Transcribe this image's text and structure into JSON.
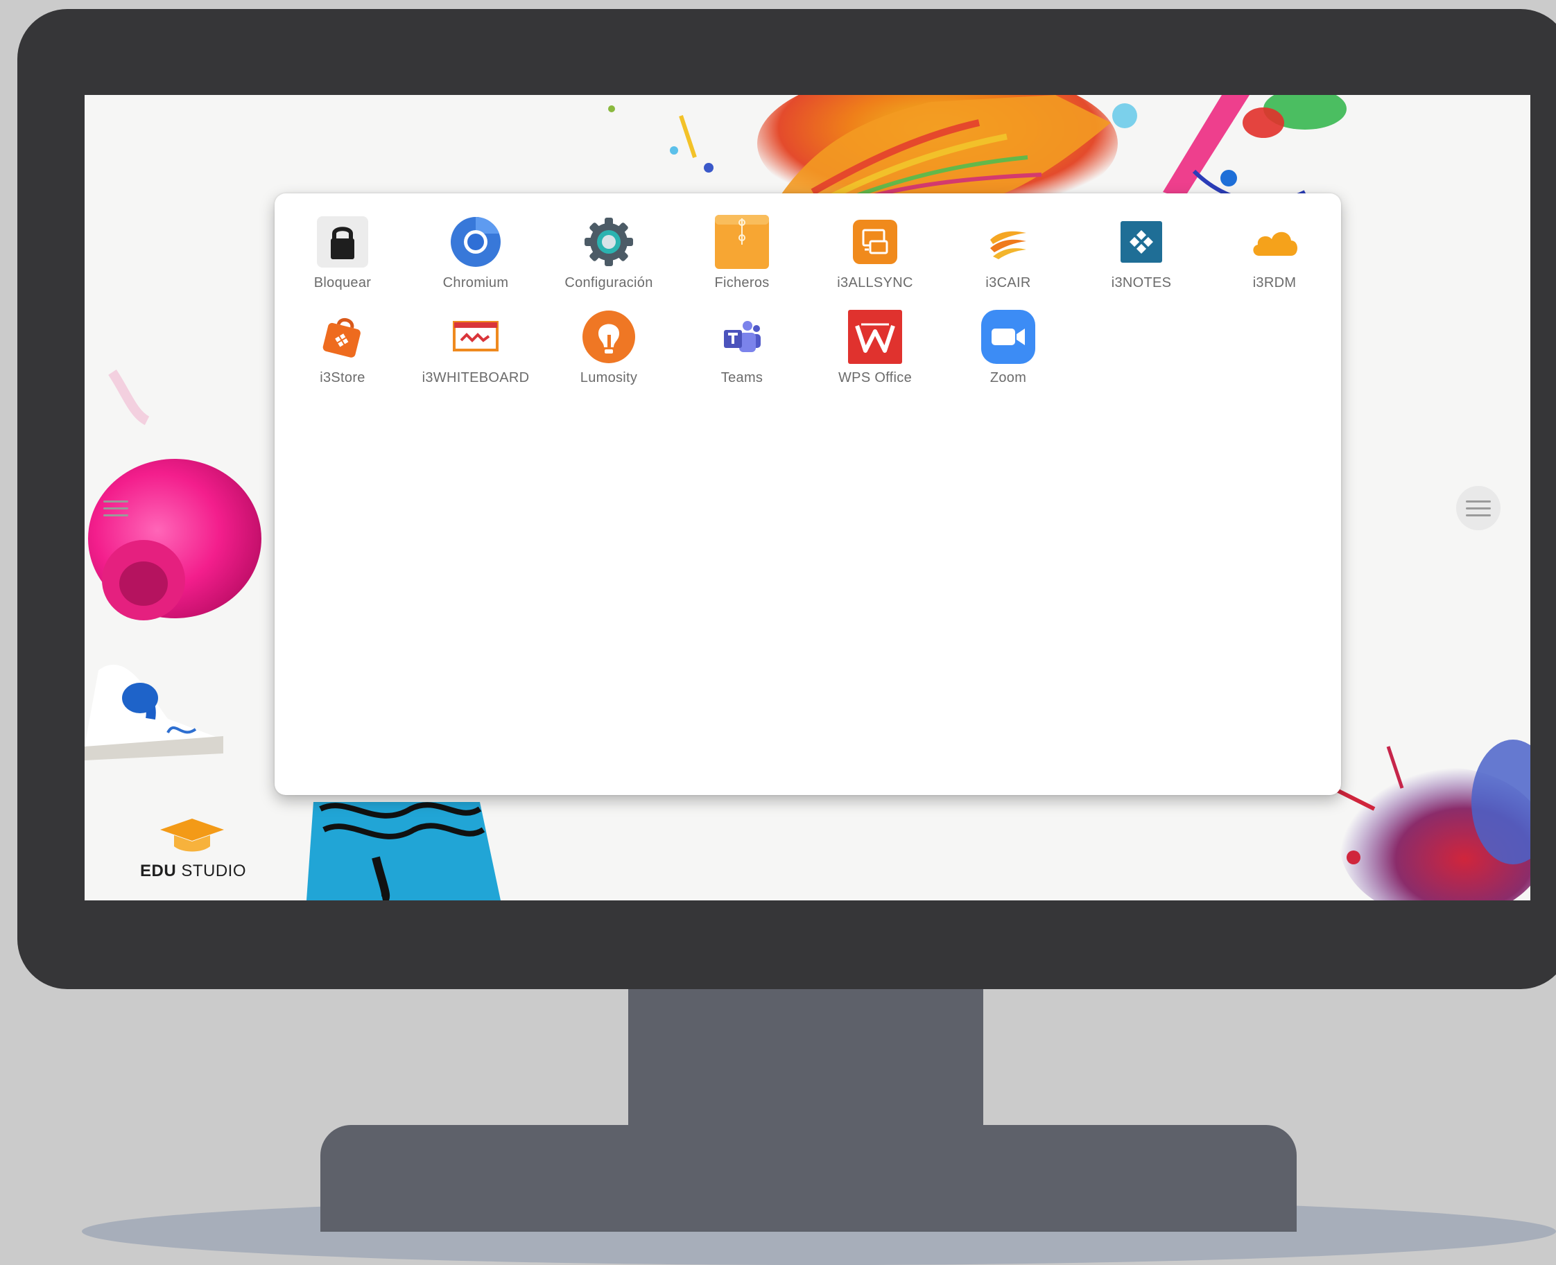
{
  "desktop": {
    "logo": {
      "bold": "EDU",
      "light": "STUDIO"
    },
    "apps": [
      {
        "label": "Bloquear",
        "icon": "lock-icon"
      },
      {
        "label": "Chromium",
        "icon": "chromium-icon"
      },
      {
        "label": "Configuración",
        "icon": "gear-icon"
      },
      {
        "label": "Ficheros",
        "icon": "folder-icon"
      },
      {
        "label": "i3ALLSYNC",
        "icon": "i3allsync-icon"
      },
      {
        "label": "i3CAIR",
        "icon": "i3cair-icon"
      },
      {
        "label": "i3NOTES",
        "icon": "i3notes-icon"
      },
      {
        "label": "i3RDM",
        "icon": "cloud-icon"
      },
      {
        "label": "i3Store",
        "icon": "store-bag-icon"
      },
      {
        "label": "i3WHITEBOARD",
        "icon": "whiteboard-icon"
      },
      {
        "label": "Lumosity",
        "icon": "lumosity-icon"
      },
      {
        "label": "Teams",
        "icon": "teams-icon"
      },
      {
        "label": "WPS Office",
        "icon": "wps-office-icon"
      },
      {
        "label": "Zoom",
        "icon": "zoom-camera-icon"
      }
    ]
  },
  "colors": {
    "bezel": "#363638",
    "stand": "#5e616a",
    "background": "#cbcbcb",
    "zoom_blue": "#3c8cf5",
    "wps_red": "#e0322e",
    "ficheros_orange": "#f7a633"
  }
}
